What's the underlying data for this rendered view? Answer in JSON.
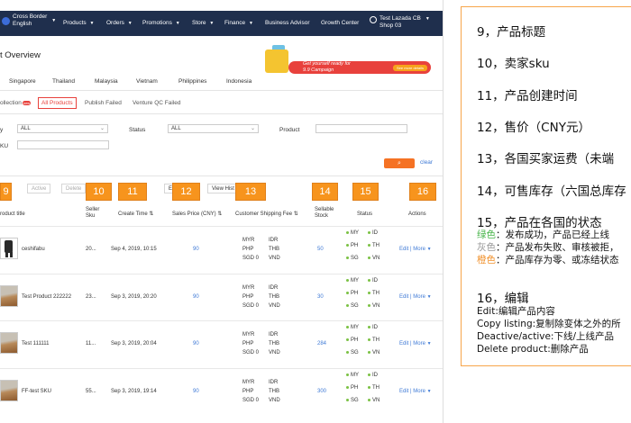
{
  "nav": {
    "brand": "Cross Border",
    "lang": "English",
    "menu": [
      "Products",
      "Orders",
      "Promotions",
      "Store",
      "Finance",
      "Business Advisor",
      "Growth Center"
    ],
    "shop_line1": "Test Lazada CB",
    "shop_line2": "Shop 03"
  },
  "page_title": "t Overview",
  "banner": {
    "line1": "Get yourself ready for",
    "line2": "9.9 Campaign",
    "btn": "See more details"
  },
  "countries": [
    "Singapore",
    "Thailand",
    "Malaysia",
    "Vietnam",
    "Philippines",
    "Indonesia"
  ],
  "subtabs": {
    "collection": "ollection",
    "collection_badge": "new",
    "all": "All Products",
    "publish_failed": "Publish Failed",
    "venture": "Venture QC Failed"
  },
  "filters": {
    "label1": "y",
    "select1": "ALL",
    "label2": "Status",
    "select2": "ALL",
    "label3": "Product",
    "label4": "KU",
    "clear": "clear"
  },
  "toolbar": {
    "active": "Active",
    "delete": "Delete",
    "e": "E",
    "view_history": "View Hist"
  },
  "number_boxes": [
    "9",
    "10",
    "11",
    "12",
    "13",
    "14",
    "15",
    "16"
  ],
  "headers": {
    "title": "roduct title",
    "seller_sku_1": "Seller",
    "seller_sku_2": "Sku",
    "create_time": "Create Time",
    "price": "Sales Price (CNY)",
    "shipping": "Customer Shipping Fee",
    "stock_1": "Sellable",
    "stock_2": "Stock",
    "status": "Status",
    "actions": "Actions"
  },
  "rows": [
    {
      "title": "ceshifabu",
      "sku": "20...",
      "time": "Sep 4, 2019, 10:15",
      "price": "90",
      "stock": "50",
      "myr": "MYR",
      "php": "PHP",
      "sgd": "SGD 0",
      "idr": "IDR",
      "thb": "THB",
      "vnd": "VND",
      "my": "MY",
      "ph": "PH",
      "sg": "SG",
      "id": "ID",
      "th": "TH",
      "vn": "VN",
      "edit": "Edit",
      "more": "More",
      "thumb": "shirt"
    },
    {
      "title": "Test Product 222222",
      "sku": "23...",
      "time": "Sep 3, 2019, 20:20",
      "price": "90",
      "stock": "30",
      "myr": "MYR",
      "php": "PHP",
      "sgd": "SGD 0",
      "idr": "IDR",
      "thb": "THB",
      "vnd": "VND",
      "my": "MY",
      "ph": "PH",
      "sg": "SG",
      "id": "ID",
      "th": "TH",
      "vn": "VN",
      "edit": "Edit",
      "more": "More",
      "thumb": "dune"
    },
    {
      "title": "Test 111111",
      "sku": "11...",
      "time": "Sep 3, 2019, 20:04",
      "price": "90",
      "stock": "284",
      "myr": "MYR",
      "php": "PHP",
      "sgd": "SGD 0",
      "idr": "IDR",
      "thb": "THB",
      "vnd": "VND",
      "my": "MY",
      "ph": "PH",
      "sg": "SG",
      "id": "ID",
      "th": "TH",
      "vn": "VN",
      "edit": "Edit",
      "more": "More",
      "thumb": "dune"
    },
    {
      "title": "FF-test SKU",
      "sku": "55...",
      "time": "Sep 3, 2019, 19:14",
      "price": "90",
      "stock": "300",
      "myr": "MYR",
      "php": "PHP",
      "sgd": "SGD 0",
      "idr": "IDR",
      "thb": "THB",
      "vnd": "VND",
      "my": "MY",
      "ph": "PH",
      "sg": "SG",
      "id": "ID",
      "th": "TH",
      "vn": "VN",
      "edit": "Edit",
      "more": "More",
      "thumb": "dune"
    }
  ],
  "notes": {
    "n9": "9，产品标题",
    "n10": "10，卖家sku",
    "n11": "11，产品创建时间",
    "n12": "12，售价（CNY元）",
    "n13": "13，各国买家运费（未端",
    "n14": "14，可售库存（六国总库存",
    "n15": "15，产品在各国的状态",
    "n15_green_key": "绿色",
    "n15_green": "：发布成功，产品已经上线",
    "n15_gray_key": "灰色",
    "n15_gray": "：产品发布失败、审核被拒，",
    "n15_orange_key": "橙色",
    "n15_orange": "：产品库存为零、或冻结状态",
    "n16": "16，编辑",
    "n16_a": "Edit:编辑产品内容",
    "n16_b": "Copy listing:复制除变体之外的所",
    "n16_c": "Deactive/active:下线/上线产品",
    "n16_d": "Delete product:删除产品"
  },
  "colors": {
    "nav_bg": "#1f2f4d",
    "accent": "#f57224",
    "link": "#3f7ad6",
    "box": "#f7941d",
    "status_green": "#7ac143"
  }
}
